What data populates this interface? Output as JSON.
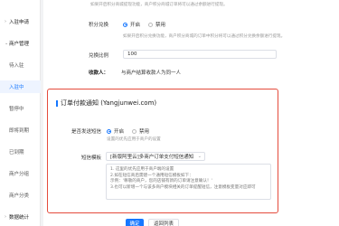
{
  "sidebar": {
    "items": [
      {
        "label": "入驻申请",
        "arrow": "›",
        "kind": "group"
      },
      {
        "label": "商户管理",
        "arrow": "⌄",
        "kind": "group"
      },
      {
        "label": "待入驻",
        "arrow": "",
        "kind": "sub"
      },
      {
        "label": "入驻中",
        "arrow": "",
        "kind": "sub-active"
      },
      {
        "label": "暂停中",
        "arrow": "",
        "kind": "sub"
      },
      {
        "label": "即将到期",
        "arrow": "",
        "kind": "sub"
      },
      {
        "label": "已到期",
        "arrow": "",
        "kind": "sub"
      },
      {
        "label": "商户分组",
        "arrow": "",
        "kind": "sub"
      },
      {
        "label": "商户分类",
        "arrow": "",
        "kind": "sub"
      },
      {
        "label": "数据统计",
        "arrow": "›",
        "kind": "group"
      }
    ]
  },
  "form": {
    "top_desc": "如果开启积分商城提现功能，商户积分商城订单将可以通过余额进行提现。",
    "points_label": "积分兑换",
    "points_on": "开启",
    "points_off": "禁用",
    "points_desc": "如果开启积分兑换功能，商户积分商城的订单中积分将可以通过积分兑换余额进行提现。",
    "ratio_label": "兑换比例",
    "ratio_value": "100",
    "recipient_label": "收款人：",
    "recipient_value": "与商户结算收款人为同一人"
  },
  "notice": {
    "title": "订单付款通知 (Yangjunwei.com)",
    "send_label": "是否发送短信",
    "send_on": "开启",
    "send_off": "禁用",
    "send_desc": "设置的优先应用于商户的设置",
    "template_label": "短信模板",
    "template_value": "[新版阿里云]多商户订单支付短信通知",
    "template_caret": "⌄",
    "hints": [
      "1. 这里的优先应用于商户端的设置",
      "2.如在短信商后需建一个通用短信模板如下：",
      "示例：'尊敬的商户，您的店铺有新的订单请注意确认！'",
      "",
      "3.也可以新增一个与该多商户模块相关的订单提醒短信，注意模板变量对应即可"
    ]
  },
  "actions": {
    "submit": "确定",
    "back": "返回列表"
  },
  "colors": {
    "accent": "#1677ff",
    "highlight_border": "#e54b3c"
  }
}
